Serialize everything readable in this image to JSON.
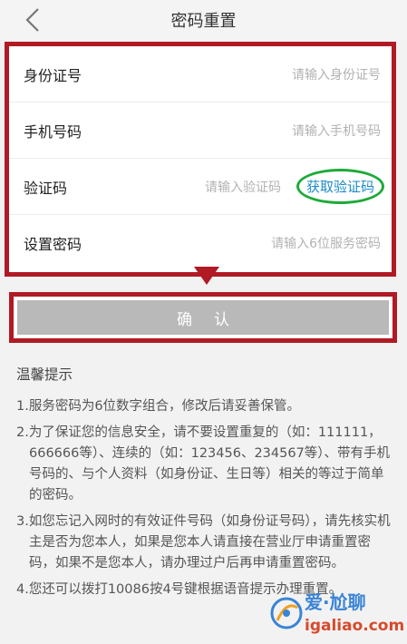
{
  "header": {
    "title": "密码重置"
  },
  "form": {
    "id_card": {
      "label": "身份证号",
      "placeholder": "请输入身份证号"
    },
    "phone": {
      "label": "手机号码",
      "placeholder": "请输入手机号码"
    },
    "code": {
      "label": "验证码",
      "placeholder": "请输入验证码",
      "get_code": "获取验证码"
    },
    "password": {
      "label": "设置密码",
      "placeholder": "请输入6位服务密码"
    }
  },
  "confirm": {
    "label": "确认"
  },
  "tips": {
    "title": "温馨提示",
    "items": [
      "1.服务密码为6位数字组合，修改后请妥善保管。",
      "2.为了保证您的信息安全，请不要设置重复的（如：111111，666666等）、连续的（如：123456、234567等）、带有手机号码的、与个人资料（如身份证、生日等）相关的等过于简单的密码。",
      "3.如您忘记入网时的有效证件号码（如身份证号码），请先核实机主是否为您本人，如果是您本人请直接在营业厅申请重置密码，如果不是您本人，请办理过户后再申请重置密码。",
      "4.您还可以拨打10086按4号键根据语音提示办理重置。"
    ]
  },
  "watermark": {
    "top": "爱·尬聊",
    "bottom": "igaliao.com"
  },
  "colors": {
    "annotation_red": "#b01a24",
    "annotation_green": "#1eaa38",
    "link_blue": "#1a8ac9",
    "button_gray": "#b9b9b9"
  }
}
